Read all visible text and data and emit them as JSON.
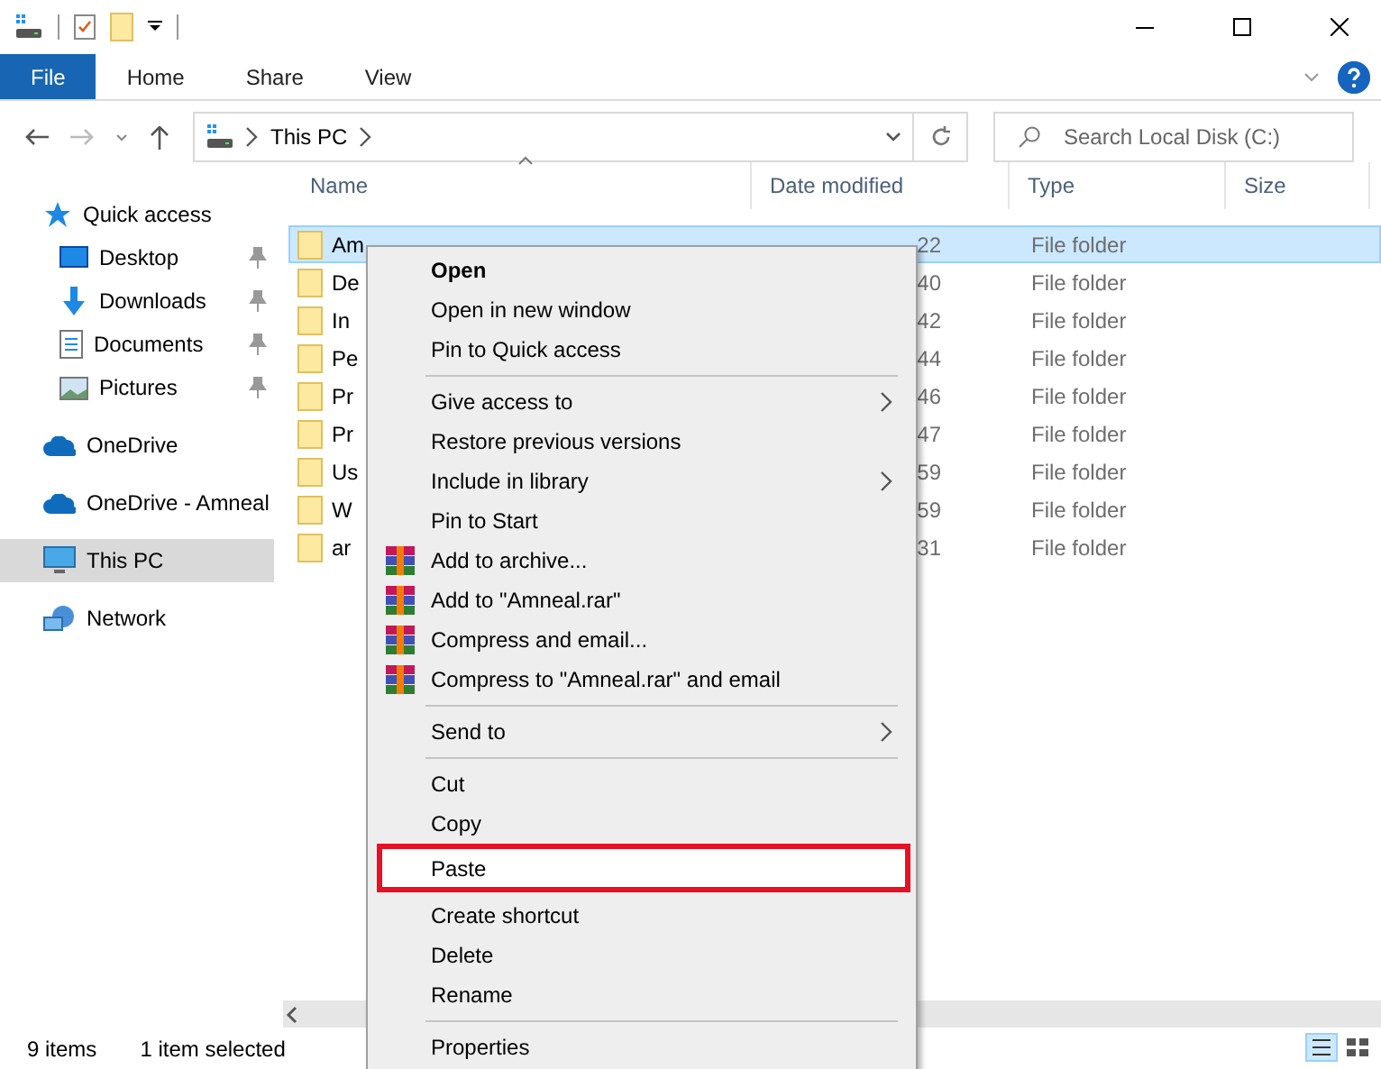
{
  "ribbon_tabs": [
    {
      "label": "File",
      "selected": true
    },
    {
      "label": "Home",
      "selected": false
    },
    {
      "label": "Share",
      "selected": false
    },
    {
      "label": "View",
      "selected": false
    }
  ],
  "address": {
    "path": [
      "This PC"
    ]
  },
  "search": {
    "placeholder": "Search Local Disk (C:)"
  },
  "sidebar": {
    "items": [
      {
        "label": "Quick access",
        "kind": "star",
        "pinned": false,
        "selected": false,
        "children": [
          {
            "label": "Desktop",
            "kind": "desktop",
            "pinned": true,
            "selected": false
          },
          {
            "label": "Downloads",
            "kind": "download",
            "pinned": true,
            "selected": false
          },
          {
            "label": "Documents",
            "kind": "document",
            "pinned": true,
            "selected": false
          },
          {
            "label": "Pictures",
            "kind": "picture",
            "pinned": true,
            "selected": false
          }
        ]
      },
      {
        "label": "OneDrive",
        "kind": "cloud",
        "pinned": false,
        "selected": false
      },
      {
        "label": "OneDrive - Amneal",
        "kind": "cloud",
        "pinned": false,
        "selected": false
      },
      {
        "label": "This PC",
        "kind": "pc",
        "pinned": false,
        "selected": true
      },
      {
        "label": "Network",
        "kind": "network",
        "pinned": false,
        "selected": false
      }
    ]
  },
  "table": {
    "columns": [
      "Name",
      "Date modified",
      "Type",
      "Size"
    ],
    "rows": [
      {
        "name": "Am",
        "date": "22",
        "type": "File folder",
        "selected": true
      },
      {
        "name": "De",
        "date": "40",
        "type": "File folder",
        "selected": false
      },
      {
        "name": "In",
        "date": "42",
        "type": "File folder",
        "selected": false
      },
      {
        "name": "Pe",
        "date": "44",
        "type": "File folder",
        "selected": false
      },
      {
        "name": "Pr",
        "date": "46",
        "type": "File folder",
        "selected": false
      },
      {
        "name": "Pr",
        "date": "47",
        "type": "File folder",
        "selected": false
      },
      {
        "name": "Us",
        "date": "59",
        "type": "File folder",
        "selected": false
      },
      {
        "name": "W",
        "date": "59",
        "type": "File folder",
        "selected": false
      },
      {
        "name": "ar",
        "date": "31",
        "type": "File folder",
        "selected": false
      }
    ]
  },
  "context_menu": [
    {
      "kind": "item",
      "label": "Open",
      "bold": true,
      "submenu": false,
      "archive_icon": false,
      "highlighted": false
    },
    {
      "kind": "item",
      "label": "Open in new window",
      "bold": false,
      "submenu": false,
      "archive_icon": false,
      "highlighted": false
    },
    {
      "kind": "item",
      "label": "Pin to Quick access",
      "bold": false,
      "submenu": false,
      "archive_icon": false,
      "highlighted": false
    },
    {
      "kind": "separator"
    },
    {
      "kind": "item",
      "label": "Give access to",
      "bold": false,
      "submenu": true,
      "archive_icon": false,
      "highlighted": false
    },
    {
      "kind": "item",
      "label": "Restore previous versions",
      "bold": false,
      "submenu": false,
      "archive_icon": false,
      "highlighted": false
    },
    {
      "kind": "item",
      "label": "Include in library",
      "bold": false,
      "submenu": true,
      "archive_icon": false,
      "highlighted": false
    },
    {
      "kind": "item",
      "label": "Pin to Start",
      "bold": false,
      "submenu": false,
      "archive_icon": false,
      "highlighted": false
    },
    {
      "kind": "item",
      "label": "Add to archive...",
      "bold": false,
      "submenu": false,
      "archive_icon": true,
      "highlighted": false
    },
    {
      "kind": "item",
      "label": "Add to \"Amneal.rar\"",
      "bold": false,
      "submenu": false,
      "archive_icon": true,
      "highlighted": false
    },
    {
      "kind": "item",
      "label": "Compress and email...",
      "bold": false,
      "submenu": false,
      "archive_icon": true,
      "highlighted": false
    },
    {
      "kind": "item",
      "label": "Compress to \"Amneal.rar\" and email",
      "bold": false,
      "submenu": false,
      "archive_icon": true,
      "highlighted": false
    },
    {
      "kind": "separator"
    },
    {
      "kind": "item",
      "label": "Send to",
      "bold": false,
      "submenu": true,
      "archive_icon": false,
      "highlighted": false
    },
    {
      "kind": "separator"
    },
    {
      "kind": "item",
      "label": "Cut",
      "bold": false,
      "submenu": false,
      "archive_icon": false,
      "highlighted": false
    },
    {
      "kind": "item",
      "label": "Copy",
      "bold": false,
      "submenu": false,
      "archive_icon": false,
      "highlighted": false
    },
    {
      "kind": "item",
      "label": "Paste",
      "bold": false,
      "submenu": false,
      "archive_icon": false,
      "highlighted": true
    },
    {
      "kind": "item",
      "label": "Create shortcut",
      "bold": false,
      "submenu": false,
      "archive_icon": false,
      "highlighted": false
    },
    {
      "kind": "item",
      "label": "Delete",
      "bold": false,
      "submenu": false,
      "archive_icon": false,
      "highlighted": false
    },
    {
      "kind": "item",
      "label": "Rename",
      "bold": false,
      "submenu": false,
      "archive_icon": false,
      "highlighted": false
    },
    {
      "kind": "separator"
    },
    {
      "kind": "item",
      "label": "Properties",
      "bold": false,
      "submenu": false,
      "archive_icon": false,
      "highlighted": false
    }
  ],
  "status_bar": {
    "item_count": "9 items",
    "selection": "1 item selected"
  }
}
